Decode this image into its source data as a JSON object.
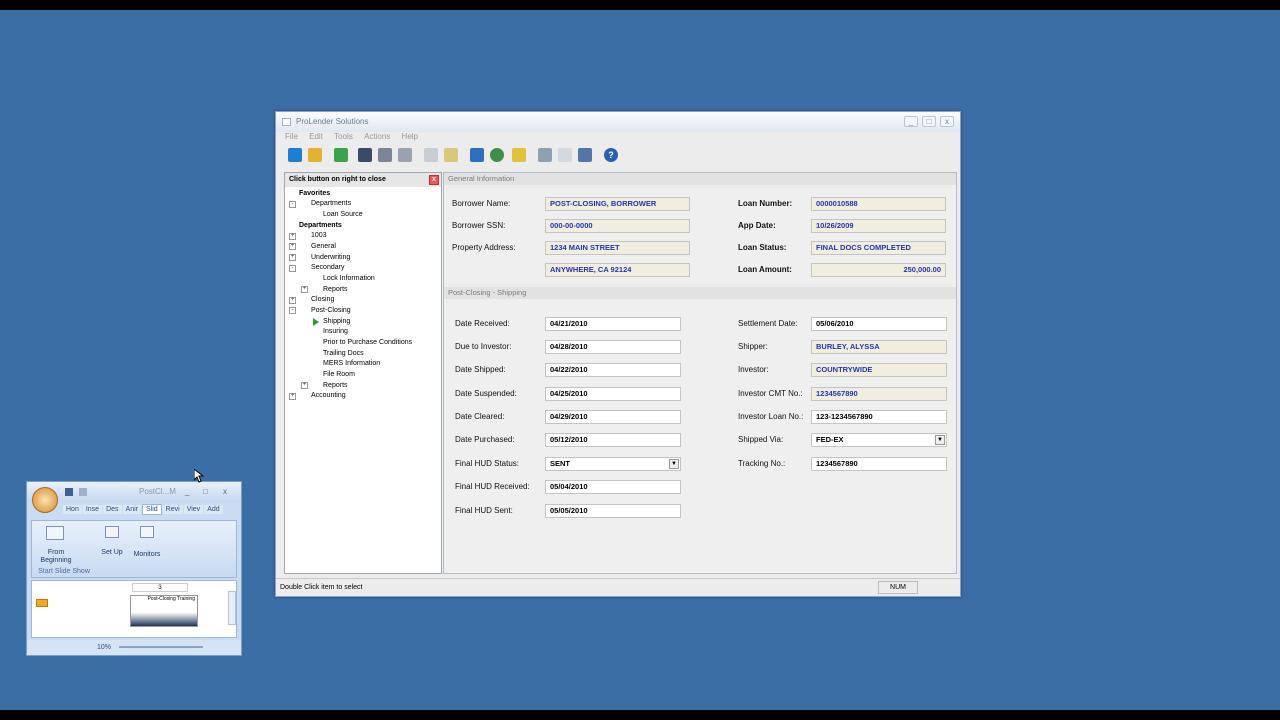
{
  "window": {
    "title": "ProLender Solutions",
    "minimize": "_",
    "maximize": "□",
    "close": "x"
  },
  "menu": [
    "File",
    "Edit",
    "Tools",
    "Actions",
    "Help"
  ],
  "toolbar": [
    "tree-icon",
    "folder-add-icon",
    "refresh-icon",
    "save-icon",
    "undo-icon",
    "print-icon",
    "copy-icon",
    "preview-icon",
    "flag-icon",
    "globe-icon",
    "folder-icon",
    "search-icon",
    "mail-icon",
    "checklist-icon",
    "help-icon"
  ],
  "left_pane": {
    "header": "Click button on right to close",
    "close_glyph": "x",
    "tree": [
      {
        "label": "Favorites",
        "bold": true
      },
      {
        "label": "Departments",
        "expander": "-"
      },
      {
        "label": "Loan Source"
      },
      {
        "label": "Departments",
        "bold": true
      },
      {
        "label": "1003",
        "expander": "+"
      },
      {
        "label": "General",
        "expander": "+"
      },
      {
        "label": "Underwriting",
        "expander": "+"
      },
      {
        "label": "Secondary",
        "expander": "-"
      },
      {
        "label": "Lock Information"
      },
      {
        "label": "Reports",
        "expander": "+"
      },
      {
        "label": "Closing",
        "expander": "+"
      },
      {
        "label": "Post-Closing",
        "expander": "-"
      },
      {
        "label": "Shipping",
        "selected": true
      },
      {
        "label": "Insuring"
      },
      {
        "label": "Prior to Purchase Conditions"
      },
      {
        "label": "Trailing Docs"
      },
      {
        "label": "MERS Information"
      },
      {
        "label": "File Room"
      },
      {
        "label": "Reports",
        "expander": "+"
      },
      {
        "label": "Accounting",
        "expander": "+"
      }
    ]
  },
  "general": {
    "header": "General Information",
    "borrower_name_label": "Borrower Name:",
    "borrower_name": "POST-CLOSING, BORROWER",
    "borrower_ssn_label": "Borrower SSN:",
    "borrower_ssn": "000-00-0000",
    "property_address_label": "Property Address:",
    "address_line1": "1234 MAIN STREET",
    "address_line2": "ANYWHERE, CA  92124",
    "loan_number_label": "Loan Number:",
    "loan_number": "0000010588",
    "app_date_label": "App Date:",
    "app_date": "10/26/2009",
    "loan_status_label": "Loan Status:",
    "loan_status": "FINAL DOCS COMPLETED",
    "loan_amount_label": "Loan Amount:",
    "loan_amount": "250,000.00"
  },
  "shipping": {
    "header": "Post-Closing - Shipping",
    "left": [
      {
        "label": "Date Received:",
        "value": "04/21/2010"
      },
      {
        "label": "Due to Investor:",
        "value": "04/28/2010"
      },
      {
        "label": "Date Shipped:",
        "value": "04/22/2010"
      },
      {
        "label": "Date Suspended:",
        "value": "04/25/2010"
      },
      {
        "label": "Date Cleared:",
        "value": "04/29/2010"
      },
      {
        "label": "Date Purchased:",
        "value": "05/12/2010"
      },
      {
        "label": "Final HUD Status:",
        "value": "SENT"
      },
      {
        "label": "Final HUD Received:",
        "value": "05/04/2010"
      },
      {
        "label": "Final HUD Sent:",
        "value": "05/05/2010"
      }
    ],
    "right": [
      {
        "label": "Settlement Date:",
        "value": "05/06/2010"
      },
      {
        "label": "Shipper:",
        "value": "BURLEY, ALYSSA"
      },
      {
        "label": "Investor:",
        "value": "COUNTRYWIDE"
      },
      {
        "label": "Investor CMT No.:",
        "value": "1234567890"
      },
      {
        "label": "Investor Loan No.:",
        "value": "123-1234567890"
      },
      {
        "label": "Shipped Via:",
        "value": "FED-EX"
      },
      {
        "label": "Tracking No.:",
        "value": "1234567890"
      }
    ]
  },
  "status_bar": {
    "message": "Double Click item to select",
    "num": "NUM"
  },
  "powerpoint": {
    "title": "PostCl...M",
    "tabs": [
      "Hon",
      "Inse",
      "Des",
      "Anir",
      "Slid",
      "Revi",
      "Viev",
      "Add"
    ],
    "from_beginning": "From Beginning",
    "set_up": "Set Up",
    "monitors": "Monitors",
    "group": "Start Slide Show",
    "slide_number": "3",
    "slide_title": "Post-Closing Training",
    "zoom": "10%"
  }
}
